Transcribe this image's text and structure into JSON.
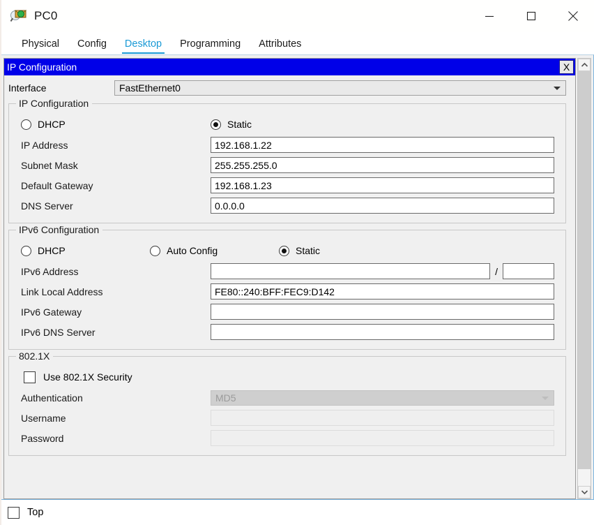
{
  "window": {
    "title": "PC0",
    "icon": "pc-device-icon",
    "controls": {
      "minimize": "minimize-icon",
      "maximize": "maximize-icon",
      "close": "close-icon"
    }
  },
  "tabs": [
    {
      "label": "Physical",
      "active": false
    },
    {
      "label": "Config",
      "active": false
    },
    {
      "label": "Desktop",
      "active": true
    },
    {
      "label": "Programming",
      "active": false
    },
    {
      "label": "Attributes",
      "active": false
    }
  ],
  "ip_configuration_window": {
    "caption": "IP Configuration",
    "close_label": "X",
    "interface": {
      "label": "Interface",
      "value": "FastEthernet0",
      "options": [
        "FastEthernet0"
      ]
    },
    "ipv4": {
      "group_title": "IP Configuration",
      "mode_options": [
        {
          "label": "DHCP",
          "selected": false
        },
        {
          "label": "Static",
          "selected": true
        }
      ],
      "fields": [
        {
          "label": "IP Address",
          "value": "192.168.1.22"
        },
        {
          "label": "Subnet Mask",
          "value": "255.255.255.0"
        },
        {
          "label": "Default Gateway",
          "value": "192.168.1.23"
        },
        {
          "label": "DNS Server",
          "value": "0.0.0.0"
        }
      ]
    },
    "ipv6": {
      "group_title": "IPv6 Configuration",
      "mode_options": [
        {
          "label": "DHCP",
          "selected": false
        },
        {
          "label": "Auto Config",
          "selected": false
        },
        {
          "label": "Static",
          "selected": true
        }
      ],
      "address": {
        "label": "IPv6 Address",
        "value": "",
        "separator": "/",
        "prefix": ""
      },
      "fields": [
        {
          "label": "Link Local Address",
          "value": "FE80::240:BFF:FEC9:D142"
        },
        {
          "label": "IPv6 Gateway",
          "value": ""
        },
        {
          "label": "IPv6 DNS Server",
          "value": ""
        }
      ]
    },
    "dot1x": {
      "group_title": "802.1X",
      "use_security": {
        "label": "Use 802.1X Security",
        "checked": false
      },
      "authentication": {
        "label": "Authentication",
        "value": "MD5",
        "options": [
          "MD5"
        ]
      },
      "username": {
        "label": "Username",
        "value": ""
      },
      "password": {
        "label": "Password",
        "value": ""
      }
    }
  },
  "scrollbar": {
    "up": "chevron-up-icon",
    "down": "chevron-down-icon"
  },
  "bottom": {
    "top_checkbox": {
      "label": "Top",
      "checked": false
    }
  },
  "colors": {
    "accent": "#1a9ad6",
    "caption_bg": "#0000e8",
    "panel_bg": "#f0f0f0",
    "field_bg": "#ffffff"
  }
}
